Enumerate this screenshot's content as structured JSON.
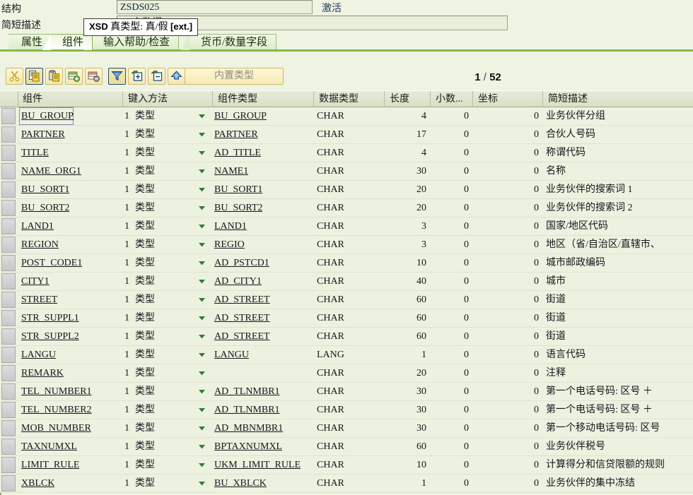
{
  "window": {
    "structure_label": "结构",
    "structure_value": "ZSDS025",
    "status_text": "激活",
    "shortdesc_label": "简短描述",
    "shortdesc_value": "BP主数据"
  },
  "tooltip": {
    "prefix": "XSD",
    "text": "真类型: 真/假",
    "suffix": "[ext.]"
  },
  "tabs": [
    {
      "label": "属性",
      "active": false
    },
    {
      "label": "组件",
      "active": true
    },
    {
      "label": "输入帮助/检查",
      "active": false
    },
    {
      "label": "货币/数量字段",
      "active": false
    }
  ],
  "toolbar": {
    "buttons": [
      {
        "name": "cut-button",
        "icon": "scissors-icon",
        "selected": false
      },
      {
        "name": "copy-button",
        "icon": "copy-icon",
        "selected": true
      },
      {
        "name": "paste-button",
        "icon": "paste-icon",
        "selected": false
      },
      {
        "name": "insert-row-button",
        "icon": "insert-row-icon",
        "selected": false
      },
      {
        "name": "delete-row-button",
        "icon": "delete-row-icon",
        "selected": false
      },
      {
        "name": "filter-button",
        "icon": "funnel-icon",
        "selected": true
      },
      {
        "name": "expand-button",
        "icon": "expand-box-icon",
        "selected": false
      },
      {
        "name": "collapse-button",
        "icon": "collapse-box-icon",
        "selected": false
      },
      {
        "name": "append-structure-button",
        "icon": "up-arrow-icon",
        "selected": false
      }
    ],
    "builtin_type_label": "内置类型"
  },
  "pager": {
    "current": "1",
    "separator": "/",
    "total": "52"
  },
  "grid": {
    "columns": [
      {
        "key": "component",
        "label": "组件"
      },
      {
        "key": "typing",
        "label": "键入方法"
      },
      {
        "key": "comp_type",
        "label": "组件类型"
      },
      {
        "key": "data_type",
        "label": "数据类型"
      },
      {
        "key": "length",
        "label": "长度"
      },
      {
        "key": "decimals",
        "label": "小数..."
      },
      {
        "key": "coord",
        "label": "坐标"
      },
      {
        "key": "short_desc",
        "label": "简短描述"
      }
    ],
    "typing_method_code": "1",
    "typing_method_label": "类型",
    "rows": [
      {
        "component": "BU_GROUP",
        "comp_type": "BU_GROUP",
        "data_type": "CHAR",
        "length": "4",
        "decimals": "0",
        "coord": "0",
        "short_desc": "业务伙伴分组",
        "focused": true
      },
      {
        "component": "PARTNER",
        "comp_type": "PARTNER",
        "data_type": "CHAR",
        "length": "17",
        "decimals": "0",
        "coord": "0",
        "short_desc": "合伙人号码"
      },
      {
        "component": "TITLE",
        "comp_type": "AD_TITLE",
        "data_type": "CHAR",
        "length": "4",
        "decimals": "0",
        "coord": "0",
        "short_desc": "称谓代码"
      },
      {
        "component": "NAME_ORG1",
        "comp_type": "NAME1",
        "data_type": "CHAR",
        "length": "30",
        "decimals": "0",
        "coord": "0",
        "short_desc": "名称"
      },
      {
        "component": "BU_SORT1",
        "comp_type": "BU_SORT1",
        "data_type": "CHAR",
        "length": "20",
        "decimals": "0",
        "coord": "0",
        "short_desc": "业务伙伴的搜索词 1"
      },
      {
        "component": "BU_SORT2",
        "comp_type": "BU_SORT2",
        "data_type": "CHAR",
        "length": "20",
        "decimals": "0",
        "coord": "0",
        "short_desc": "业务伙伴的搜索词 2"
      },
      {
        "component": "LAND1",
        "comp_type": "LAND1",
        "data_type": "CHAR",
        "length": "3",
        "decimals": "0",
        "coord": "0",
        "short_desc": "国家/地区代码"
      },
      {
        "component": "REGION",
        "comp_type": "REGIO",
        "data_type": "CHAR",
        "length": "3",
        "decimals": "0",
        "coord": "0",
        "short_desc": "地区（省/自治区/直辖市、"
      },
      {
        "component": "POST_CODE1",
        "comp_type": "AD_PSTCD1",
        "data_type": "CHAR",
        "length": "10",
        "decimals": "0",
        "coord": "0",
        "short_desc": "城市邮政编码"
      },
      {
        "component": "CITY1",
        "comp_type": "AD_CITY1",
        "data_type": "CHAR",
        "length": "40",
        "decimals": "0",
        "coord": "0",
        "short_desc": "城市"
      },
      {
        "component": "STREET",
        "comp_type": "AD_STREET",
        "data_type": "CHAR",
        "length": "60",
        "decimals": "0",
        "coord": "0",
        "short_desc": "街道"
      },
      {
        "component": "STR_SUPPL1",
        "comp_type": "AD_STREET",
        "data_type": "CHAR",
        "length": "60",
        "decimals": "0",
        "coord": "0",
        "short_desc": "街道"
      },
      {
        "component": "STR_SUPPL2",
        "comp_type": "AD_STREET",
        "data_type": "CHAR",
        "length": "60",
        "decimals": "0",
        "coord": "0",
        "short_desc": "街道"
      },
      {
        "component": "LANGU",
        "comp_type": "LANGU",
        "data_type": "LANG",
        "length": "1",
        "decimals": "0",
        "coord": "0",
        "short_desc": "语言代码"
      },
      {
        "component": "REMARK",
        "comp_type": "",
        "data_type": "CHAR",
        "length": "20",
        "decimals": "0",
        "coord": "0",
        "short_desc": "注释"
      },
      {
        "component": "TEL_NUMBER1",
        "comp_type": "AD_TLNMBR1",
        "data_type": "CHAR",
        "length": "30",
        "decimals": "0",
        "coord": "0",
        "short_desc": "第一个电话号码: 区号 ＋"
      },
      {
        "component": "TEL_NUMBER2",
        "comp_type": "AD_TLNMBR1",
        "data_type": "CHAR",
        "length": "30",
        "decimals": "0",
        "coord": "0",
        "short_desc": "第一个电话号码: 区号 ＋"
      },
      {
        "component": "MOB_NUMBER",
        "comp_type": "AD_MBNMBR1",
        "data_type": "CHAR",
        "length": "30",
        "decimals": "0",
        "coord": "0",
        "short_desc": "第一个移动电话号码: 区号"
      },
      {
        "component": "TAXNUMXL",
        "comp_type": "BPTAXNUMXL",
        "data_type": "CHAR",
        "length": "60",
        "decimals": "0",
        "coord": "0",
        "short_desc": "业务伙伴税号"
      },
      {
        "component": "LIMIT_RULE",
        "comp_type": "UKM_LIMIT_RULE",
        "data_type": "CHAR",
        "length": "10",
        "decimals": "0",
        "coord": "0",
        "short_desc": "计算得分和信贷限额的规则"
      },
      {
        "component": "XBLCK",
        "comp_type": "BU_XBLCK",
        "data_type": "CHAR",
        "length": "1",
        "decimals": "0",
        "coord": "0",
        "short_desc": "业务伙伴的集中冻结"
      }
    ]
  },
  "colors": {
    "background": "#eef3e2",
    "row_bg": "#edf2e0",
    "header_bg": "#dde4cc",
    "tab_accent": "#86b74a",
    "link_text": "#14142a"
  }
}
